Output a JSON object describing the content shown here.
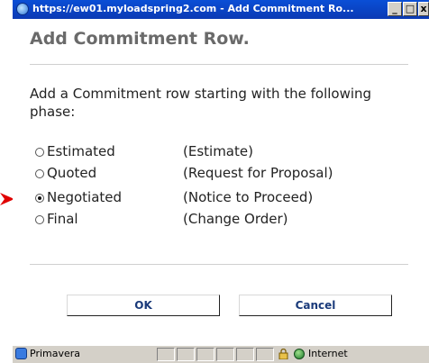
{
  "window": {
    "title": "https://ew01.myloadspring2.com - Add Commitment Ro...",
    "controls": [
      "minimize",
      "maximize",
      "close"
    ]
  },
  "dialog": {
    "heading": "Add Commitment Row.",
    "intro": "Add a Commitment row starting with the following phase:",
    "options": [
      {
        "label": "Estimated",
        "description": "(Estimate)",
        "selected": false
      },
      {
        "label": "Quoted",
        "description": "(Request for Proposal)",
        "selected": false
      },
      {
        "label": "Negotiated",
        "description": "(Notice to Proceed)",
        "selected": true
      },
      {
        "label": "Final",
        "description": "(Change Order)",
        "selected": false
      }
    ],
    "ok_label": "OK",
    "cancel_label": "Cancel"
  },
  "statusbar": {
    "page_label": "Primavera",
    "zone_label": "Internet",
    "icons": [
      "ie-page-icon",
      "lock-icon",
      "globe-icon"
    ]
  },
  "colors": {
    "titlebar": "#0b45c8",
    "heading": "#6a6a6a",
    "button_text": "#1a3a7a",
    "arrow": "#e00000"
  }
}
